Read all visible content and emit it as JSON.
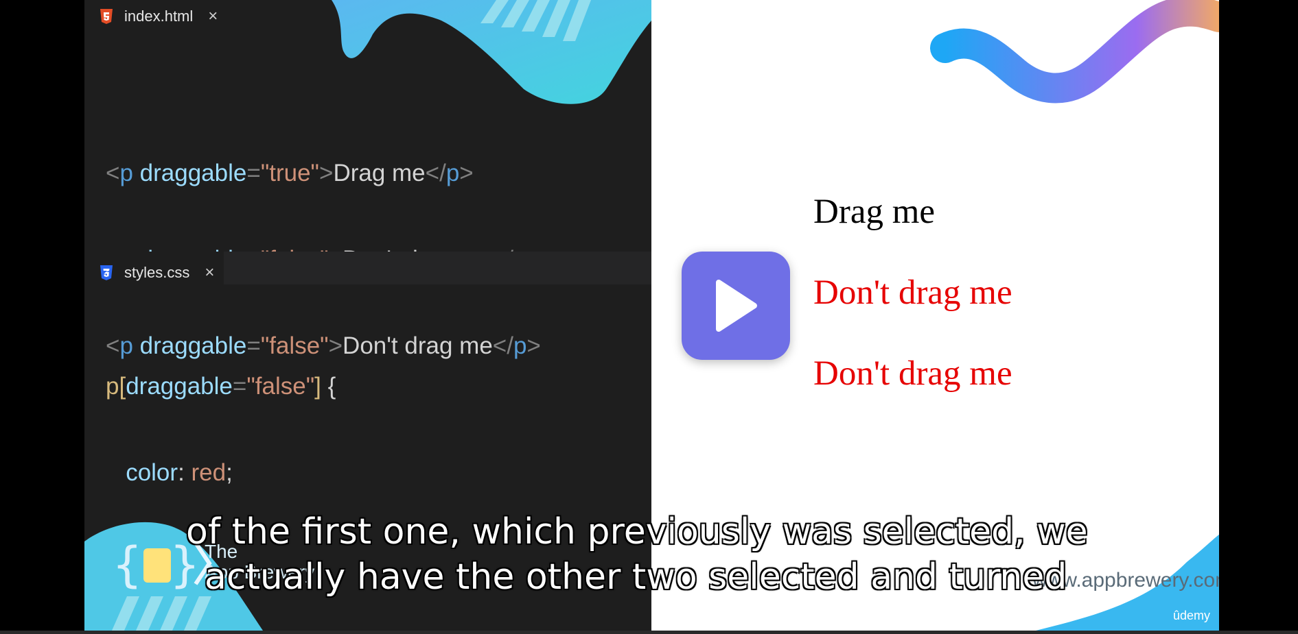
{
  "editor": {
    "html_tab": {
      "label": "index.html",
      "icon": "html5-icon",
      "close": "×"
    },
    "html_code": [
      {
        "tag": "p",
        "attr": "draggable",
        "value": "\"true\"",
        "text": "Drag me"
      },
      {
        "tag": "p",
        "attr": "draggable",
        "value": "\"false\"",
        "text": "Don't drag me"
      },
      {
        "tag": "p",
        "attr": "draggable",
        "value": "\"false\"",
        "text": "Don't drag me"
      }
    ],
    "css_tab": {
      "label": "styles.css",
      "icon": "css3-icon",
      "close": "×"
    },
    "css_code": {
      "selector_tag": "p",
      "selector_attr": "draggable",
      "selector_value": "\"false\"",
      "property": "color",
      "prop_value": "red",
      "open_brace": "{",
      "close_brace": "}"
    }
  },
  "preview": {
    "items": [
      {
        "text": "Drag me",
        "color": "#000000"
      },
      {
        "text": "Don't drag me",
        "color": "#e60000"
      },
      {
        "text": "Don't drag me",
        "color": "#e60000"
      }
    ]
  },
  "player": {
    "play_icon": "play-icon",
    "accent": "#6f6fe6"
  },
  "branding": {
    "logo_text_1": "The",
    "logo_text_2": "App Brewery",
    "url": "www.appbrewery.com",
    "udemy": "ûdemy"
  },
  "subtitles": {
    "line1": "of the first one, which previously was selected, we",
    "line2": "actually have the other two selected and turned"
  }
}
